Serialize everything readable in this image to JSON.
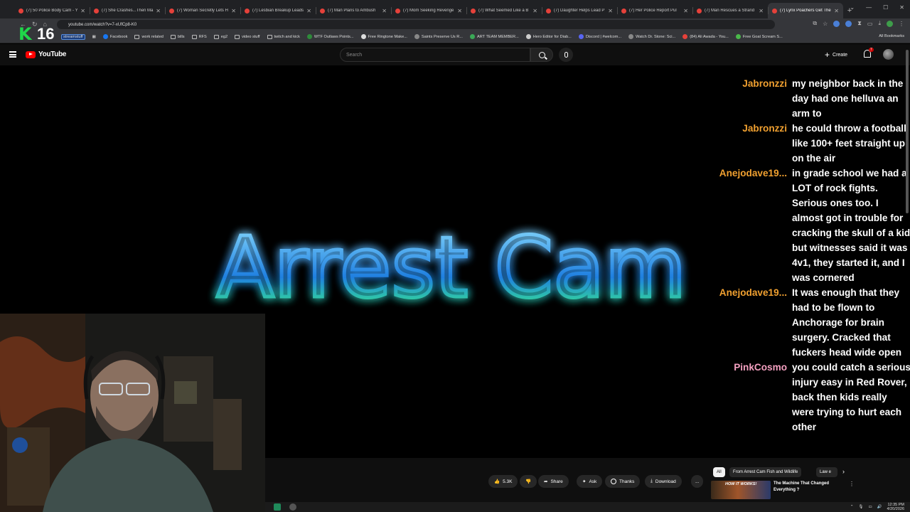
{
  "browser": {
    "tabs": [
      {
        "title": "(7) 50 Police Body Cam - Y"
      },
      {
        "title": "(7) She Crashes...Then Ma"
      },
      {
        "title": "(7) Woman Secretly Lets H"
      },
      {
        "title": "(7) Lesbian Breakup Leads"
      },
      {
        "title": "(7) Man Plans to Ambush"
      },
      {
        "title": "(7) Mom Seeking Revenge"
      },
      {
        "title": "(7) What Seemed Like a B"
      },
      {
        "title": "(7) Daughter Helps Lead P"
      },
      {
        "title": "(7) Her Police Report Pul"
      },
      {
        "title": "(7) Man Rescues a Strand"
      },
      {
        "title": "(7) Lynx Poachers Get The"
      }
    ],
    "url": "youtube.com/watch?v=7-xUfCp8-K0",
    "bookmarks": [
      "streamstuff",
      "Facebook",
      "work related",
      "bills",
      "RFS",
      "eg2",
      "video stuff",
      "twitch and kick",
      "WTF Outlaws Points...",
      "Free Ringtone Make...",
      "Saints Preserve Us R...",
      "ART TEAM MEMBER...",
      "Hero Editor for Diab...",
      "Discord | #welcom...",
      "Watch Dr. Stone: Sci...",
      "(84) Ali Awada - You...",
      "Free Goat Scream S..."
    ],
    "all_bookmarks": "All Bookmarks"
  },
  "overlay": {
    "k_logo": "K",
    "counter": "16",
    "label": "streamstuff"
  },
  "youtube": {
    "logo_text": "YouTube",
    "search_placeholder": "Search",
    "create_label": "Create",
    "notif_count": "7"
  },
  "video": {
    "title_art": "Arrest Cam",
    "colors": {
      "flame_blue": "#3fb8ff",
      "flame_green": "#3cff7a"
    }
  },
  "chat": [
    {
      "name": "Jabronzzi",
      "name_color": "#f0a030",
      "lines": [
        "my neighbor back in the",
        "day had one helluva an",
        "arm to"
      ]
    },
    {
      "name": "Jabronzzi",
      "name_color": "#f0a030",
      "lines": [
        "he could throw a football",
        "like 100+ feet straight up",
        "on the air"
      ]
    },
    {
      "name": "Anejodave19...",
      "name_color": "#f0a030",
      "lines": [
        "in grade school we had a",
        "LOT of rock fights.",
        "Serious ones too. I",
        "almost got in trouble for",
        "cracking the skull of a kid",
        "but witnesses said it was",
        "4v1, they started it, and I",
        "was cornered"
      ]
    },
    {
      "name": "Anejodave19...",
      "name_color": "#f0a030",
      "lines": [
        "It was enough that they",
        "had to be flown to",
        "Anchorage for brain",
        "surgery. Cracked that",
        "fuckers head wide open"
      ]
    },
    {
      "name": "PinkCosmo",
      "name_color": "#f4a0c0",
      "lines": [
        "you could catch a serious",
        "injury easy in Red Rover,",
        "back then kids really",
        "were trying to hurt each",
        "other"
      ]
    }
  ],
  "actions": {
    "likes": "5.3K",
    "share": "Share",
    "ask": "Ask",
    "thanks": "Thanks",
    "download": "Download",
    "more": "..."
  },
  "chips": [
    {
      "label": "All",
      "active": true
    },
    {
      "label": "From Arrest Cam Fish and Wildlife",
      "active": false
    },
    {
      "label": "Law e",
      "active": false
    }
  ],
  "recommended": {
    "thumb_text": "HOW IT WORKS!",
    "title": "The Machine That Changed Everything ?"
  },
  "taskbar": {
    "time": "12:35 PM",
    "date": "4/20/2026"
  }
}
